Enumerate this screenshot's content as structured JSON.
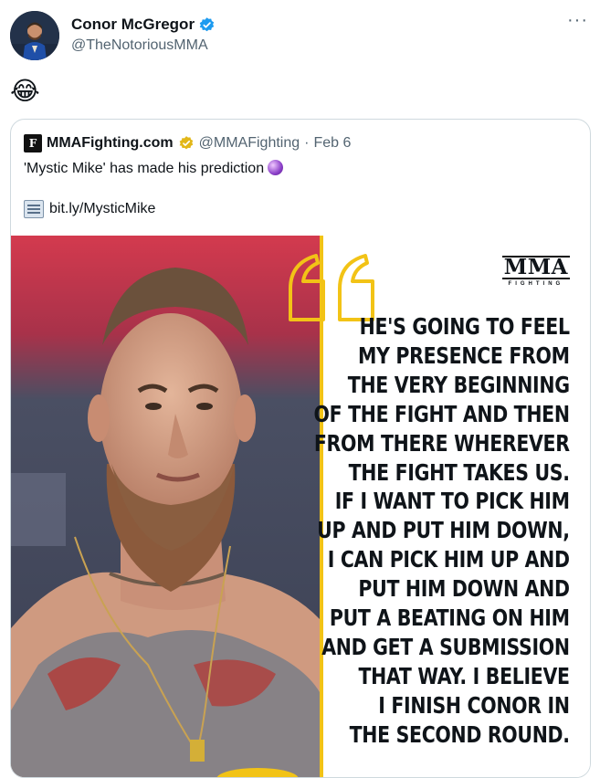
{
  "post": {
    "author_name": "Conor McGregor",
    "author_handle": "@TheNotoriousMMA",
    "more_label": "···",
    "text": "😂"
  },
  "quote": {
    "author_name": "MMAFighting.com",
    "author_handle": "@MMAFighting",
    "separator": "·",
    "date": "Feb 6",
    "text": "'Mystic Mike' has made his prediction",
    "link": "bit.ly/MysticMike",
    "logo_letter": "F",
    "image": {
      "logo_word": "MMA",
      "logo_sub": "FIGHTING",
      "lines": [
        "HE'S GOING TO FEEL",
        "MY PRESENCE FROM",
        "THE VERY BEGINNING",
        "OF THE FIGHT AND THEN",
        "FROM THERE WHEREVER",
        "THE FIGHT TAKES US.",
        "IF I WANT TO PICK HIM",
        "UP AND PUT HIM DOWN,",
        "I CAN PICK HIM UP AND",
        "PUT HIM DOWN AND",
        "PUT A BEATING ON HIM",
        "AND GET A SUBMISSION",
        "THAT WAY. I BELIEVE",
        "I FINISH CONOR IN",
        "THE SECOND ROUND."
      ]
    }
  },
  "colors": {
    "verified_blue": "#1d9bf0",
    "gold_badge": "#e2b719",
    "quote_yellow": "#f2c316",
    "muted_text": "#536471"
  }
}
